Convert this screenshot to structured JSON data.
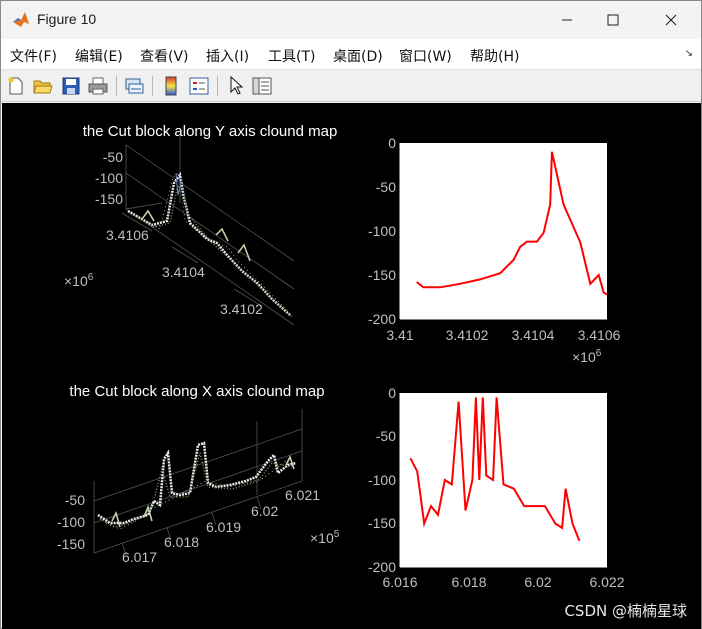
{
  "window": {
    "title": "Figure 10"
  },
  "menu": [
    "文件(F)",
    "编辑(E)",
    "查看(V)",
    "插入(I)",
    "工具(T)",
    "桌面(D)",
    "窗口(W)",
    "帮助(H)"
  ],
  "toolbar_icons": [
    "new-figure-icon",
    "open-file-icon",
    "save-icon",
    "print-icon",
    "link-plot-icon",
    "insert-colorbar-icon",
    "insert-legend-icon",
    "edit-plot-pointer-icon",
    "property-inspector-icon"
  ],
  "plots": {
    "y_cloud": {
      "title": "the Cut block along Y axis clound map",
      "z_ticks": [
        "-50",
        "-100",
        "-150"
      ],
      "axis_ticks": [
        "3.4106",
        "3.4104",
        "3.4102"
      ],
      "exponent_base": "×10",
      "exponent": "6"
    },
    "y_profile": {
      "y_ticks": [
        "0",
        "-50",
        "-100",
        "-150",
        "-200"
      ],
      "x_ticks": [
        "3.41",
        "3.4102",
        "3.4104",
        "3.4106"
      ],
      "exponent_base": "×10",
      "exponent": "6",
      "line_color": "#ff0000"
    },
    "x_cloud": {
      "title": "the Cut block along X axis clound map",
      "z_ticks": [
        "-50",
        "-100",
        "-150"
      ],
      "axis_ticks": [
        "6.017",
        "6.018",
        "6.019",
        "6.02",
        "6.021"
      ],
      "exponent_base": "×10",
      "exponent": "5"
    },
    "x_profile": {
      "y_ticks": [
        "0",
        "-50",
        "-100",
        "-150",
        "-200"
      ],
      "x_ticks": [
        "6.016",
        "6.018",
        "6.02",
        "6.022"
      ],
      "line_color": "#ff0000"
    }
  },
  "watermark": "CSDN @楠楠星球",
  "chart_data": [
    {
      "type": "line",
      "x": [
        3.41005,
        3.41007,
        3.41012,
        3.41018,
        3.41024,
        3.4103,
        3.41034,
        3.41036,
        3.41038,
        3.41041,
        3.41043,
        3.41045,
        3.410455,
        3.41049,
        3.41054,
        3.41057,
        3.410595,
        3.41061,
        3.41062
      ],
      "y": [
        -158,
        -164,
        -164,
        -160,
        -155,
        -148,
        -133,
        -118,
        -112,
        -112,
        -102,
        -70,
        -10,
        -70,
        -113,
        -160,
        -150,
        -170,
        -172
      ],
      "xlim": [
        3.41,
        3.41062
      ],
      "ylim": [
        -200,
        0
      ],
      "x_exponent": "×10^6"
    },
    {
      "type": "line",
      "x": [
        6.0163,
        6.0165,
        6.0167,
        6.0169,
        6.0171,
        6.0173,
        6.0175,
        6.0177,
        6.0179,
        6.0181,
        6.0182,
        6.0183,
        6.0184,
        6.0185,
        6.0187,
        6.0188,
        6.019,
        6.0193,
        6.0196,
        6.0199,
        6.0202,
        6.0205,
        6.0207,
        6.0208,
        6.021,
        6.0212
      ],
      "y": [
        -75,
        -90,
        -150,
        -130,
        -140,
        -100,
        -105,
        -10,
        -135,
        -100,
        -5,
        -100,
        -5,
        -95,
        -100,
        -5,
        -105,
        -110,
        -130,
        -130,
        -130,
        -150,
        -155,
        -110,
        -150,
        -170
      ],
      "xlim": [
        6.016,
        6.022
      ],
      "ylim": [
        -200,
        0
      ]
    }
  ]
}
